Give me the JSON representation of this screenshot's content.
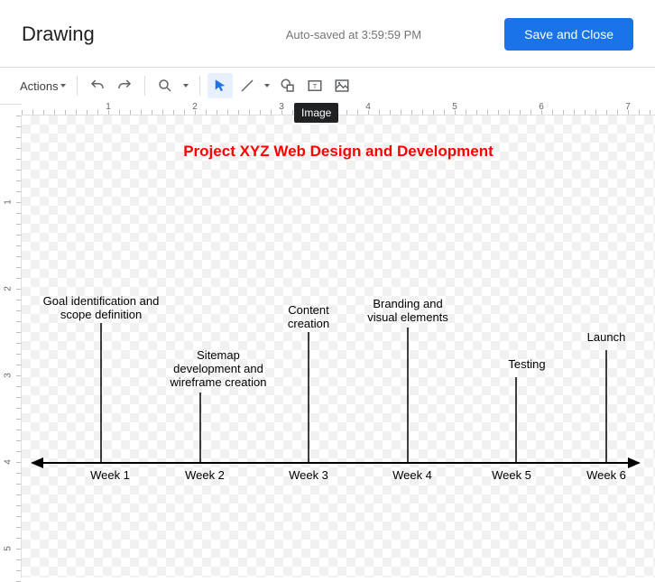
{
  "header": {
    "title": "Drawing",
    "autosave": "Auto-saved at 3:59:59 PM",
    "save_button": "Save and Close"
  },
  "toolbar": {
    "actions_label": "Actions"
  },
  "tooltip": {
    "image": "Image"
  },
  "ruler": {
    "h": [
      "1",
      "2",
      "3",
      "4",
      "5",
      "6",
      "7"
    ],
    "v": [
      "1",
      "2",
      "3",
      "4",
      "5"
    ]
  },
  "drawing": {
    "title": "Project XYZ Web Design and Development",
    "weeks": [
      "Week 1",
      "Week 2",
      "Week 3",
      "Week 4",
      "Week 5",
      "Week 6"
    ],
    "events": {
      "e1": {
        "l1": "Goal identification and",
        "l2": "scope definition"
      },
      "e2": {
        "l1": "Sitemap",
        "l2": "development and",
        "l3": "wireframe creation"
      },
      "e3": {
        "l1": "Content",
        "l2": "creation"
      },
      "e4": {
        "l1": "Branding and",
        "l2": "visual elements"
      },
      "e5": {
        "l1": "Testing"
      },
      "e6": {
        "l1": "Launch"
      }
    }
  },
  "chart_data": {
    "type": "timeline",
    "title": "Project XYZ Web Design and Development",
    "categories": [
      "Week 1",
      "Week 2",
      "Week 3",
      "Week 4",
      "Week 5",
      "Week 6"
    ],
    "events": [
      {
        "position": 1,
        "label": "Goal identification and scope definition"
      },
      {
        "position": 2,
        "label": "Sitemap development and wireframe creation"
      },
      {
        "position": 3,
        "label": "Content creation"
      },
      {
        "position": 4,
        "label": "Branding and visual elements"
      },
      {
        "position": 5,
        "label": "Testing"
      },
      {
        "position": 6,
        "label": "Launch"
      }
    ]
  }
}
